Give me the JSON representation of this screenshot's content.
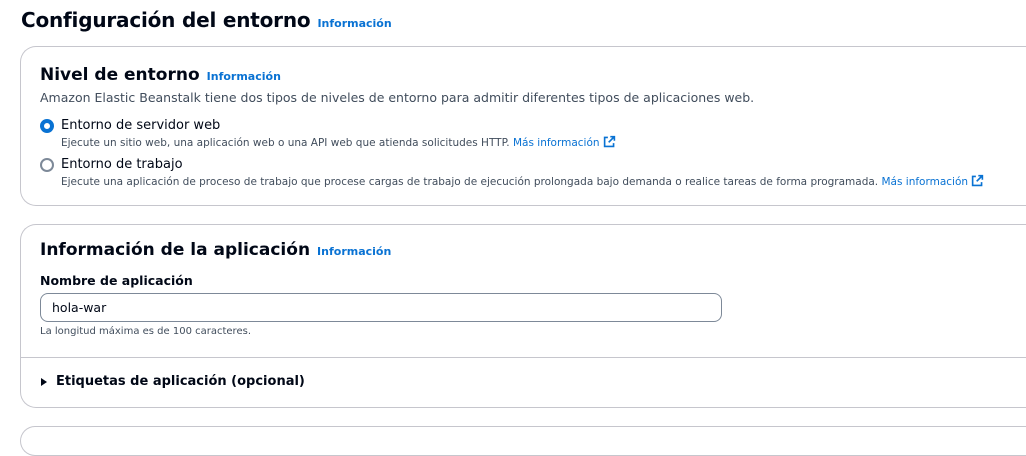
{
  "page": {
    "title": "Configuración del entorno",
    "info_link": "Información"
  },
  "tier_card": {
    "title": "Nivel de entorno",
    "info_link": "Información",
    "description": "Amazon Elastic Beanstalk tiene dos tipos de niveles de entorno para admitir diferentes tipos de aplicaciones web.",
    "options": [
      {
        "label": "Entorno de servidor web",
        "description": "Ejecute un sitio web, una aplicación web o una API web que atienda solicitudes HTTP.",
        "link": "Más información",
        "selected": true
      },
      {
        "label": "Entorno de trabajo",
        "description": "Ejecute una aplicación de proceso de trabajo que procese cargas de trabajo de ejecución prolongada bajo demanda o realice tareas de forma programada.",
        "link": "Más información",
        "selected": false
      }
    ]
  },
  "app_card": {
    "title": "Información de la aplicación",
    "info_link": "Información",
    "name_label": "Nombre de aplicación",
    "name_value": "hola-war",
    "constraint": "La longitud máxima es de 100 caracteres.",
    "tags_expander": "Etiquetas de aplicación (opcional)"
  },
  "colors": {
    "link": "#0972d3",
    "text": "#000716",
    "secondary_text": "#414d5c",
    "border": "#c6c6cd"
  }
}
